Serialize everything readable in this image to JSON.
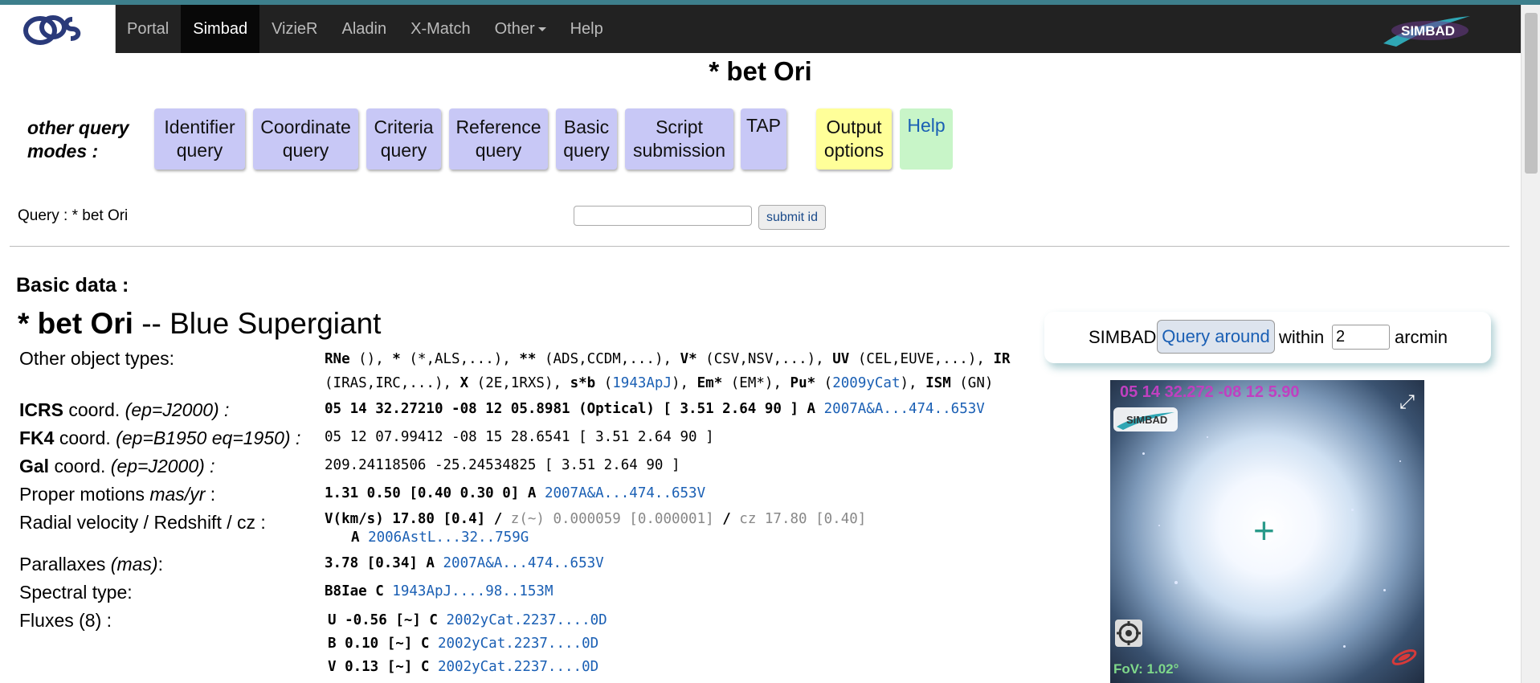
{
  "nav": {
    "items": [
      "Portal",
      "Simbad",
      "VizieR",
      "Aladin",
      "X-Match",
      "Other",
      "Help"
    ],
    "brand": "SIMBAD"
  },
  "page_title": "* bet Ori",
  "query_modes": {
    "label_line1": "other query",
    "label_line2": "modes :",
    "buttons": [
      {
        "line1": "Identifier",
        "line2": "query"
      },
      {
        "line1": "Coordinate",
        "line2": "query"
      },
      {
        "line1": "Criteria",
        "line2": "query"
      },
      {
        "line1": "Reference",
        "line2": "query"
      },
      {
        "line1": "Basic",
        "line2": "query"
      },
      {
        "line1": "Script",
        "line2": "submission"
      },
      {
        "line1": "TAP",
        "line2": ""
      },
      {
        "line1": "Output",
        "line2": "options"
      },
      {
        "line1": "Help",
        "line2": ""
      }
    ]
  },
  "query": {
    "text": "Query : * bet Ori",
    "input_value": "",
    "submit_label": "submit id"
  },
  "basic_data": {
    "heading": "Basic data :",
    "object_name": "* bet Ori",
    "object_type": "-- Blue Supergiant",
    "other_types_label": "Other object types:",
    "other_types_line1": [
      {
        "code": "RNe",
        "detail": " ()"
      },
      {
        "code": "*",
        "detail": " (*,ALS,...)"
      },
      {
        "code": "**",
        "detail": " (ADS,CCDM,...)"
      },
      {
        "code": "V*",
        "detail": " (CSV,NSV,...)"
      },
      {
        "code": "UV",
        "detail": " (CEL,EUVE,...)"
      },
      {
        "code": "IR",
        "detail": ""
      }
    ],
    "other_types_line2": {
      "p1": "(IRAS,IRC,...), ",
      "x": "X",
      "p2": " (2E,1RXS), ",
      "sb": "s*b",
      "p3": " (",
      "sb_ref": "1943ApJ",
      "p4": "), ",
      "em": "Em*",
      "p5": " (EM*), ",
      "pu": "Pu*",
      "p6": " (",
      "pu_ref": "2009yCat",
      "p7": "), ",
      "ism": "ISM",
      "p8": " (GN)"
    },
    "icrs": {
      "label_bold": "ICRS",
      "label_rest": " coord. ",
      "label_ep": "(ep=J2000) :",
      "value": "05 14 32.27210 -08 12 05.8981 (Optical) [ 3.51 2.64 90 ] A ",
      "ref": "2007A&A...474..653V"
    },
    "fk4": {
      "label_bold": "FK4",
      "label_rest": " coord. ",
      "label_ep": "(ep=B1950 eq=1950) :",
      "value": "05 12 07.99412 -08 15 28.6541 [ 3.51 2.64 90 ]"
    },
    "gal": {
      "label_bold": "Gal",
      "label_rest": " coord. ",
      "label_ep": "(ep=J2000) :",
      "value": "209.24118506 -25.24534825 [ 3.51 2.64 90 ]"
    },
    "pm": {
      "label": "Proper motions ",
      "label_unit": "mas/yr",
      "label_colon": " :",
      "value": "1.31 0.50 [0.40 0.30 0] A ",
      "ref": "2007A&A...474..653V"
    },
    "rv": {
      "label": "Radial velocity / Redshift / cz :",
      "v": "V(km/s) 17.80 [0.4]",
      "sep": " / ",
      "z": "z(~) 0.000059 [0.000001]",
      "cz": "cz 17.80 [0.40]",
      "qual": "A ",
      "ref": "2006AstL...32..759G"
    },
    "plx": {
      "label": "Parallaxes ",
      "label_unit": "(mas)",
      "label_colon": ":",
      "value": "3.78 [0.34] A ",
      "ref": "2007A&A...474..653V"
    },
    "sp": {
      "label": "Spectral type:",
      "value": "B8Iae C ",
      "ref": "1943ApJ....98..153M"
    },
    "fluxes": {
      "label": "Fluxes (8) :",
      "rows": [
        {
          "value": "U -0.56 [~] C ",
          "ref": "2002yCat.2237....0D"
        },
        {
          "value": "B 0.10 [~] C ",
          "ref": "2002yCat.2237....0D"
        },
        {
          "value": "V 0.13 [~] C ",
          "ref": "2002yCat.2237....0D"
        }
      ]
    }
  },
  "around": {
    "simbad": "SIMBAD",
    "button": "Query around",
    "within": "within",
    "radius": "2",
    "unit": "arcmin"
  },
  "aladin": {
    "coords": "05 14 32.272 -08 12 5.90",
    "fov": "FoV: 1.02°",
    "logo": "SIMBAD"
  }
}
